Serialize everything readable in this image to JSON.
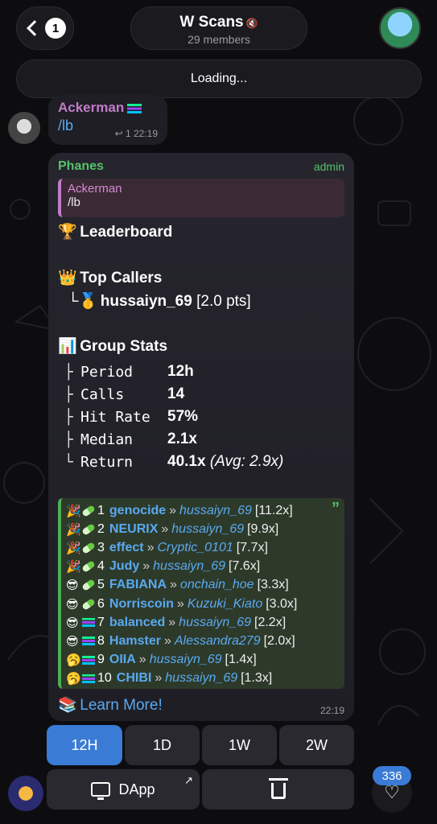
{
  "header": {
    "back_badge": "1",
    "title": "W Scans",
    "mute_icon": "muted-speaker-icon",
    "subtitle": "29 members",
    "loading": "Loading..."
  },
  "message1": {
    "sender": "Ackerman",
    "text": "/lb",
    "meta": "↩ 1  22:19"
  },
  "message2": {
    "sender": "Phanes",
    "role": "admin",
    "reply_sender": "Ackerman",
    "reply_text": "/lb",
    "leaderboard_title": "Leaderboard",
    "top_callers_title": "Top Callers",
    "top_caller_name": "hussaiyn_69",
    "top_caller_pts": "[2.0 pts]",
    "group_stats_title": "Group Stats",
    "stats": [
      {
        "tree": "├",
        "key": "Period",
        "value": "12h",
        "extra": ""
      },
      {
        "tree": "├",
        "key": "Calls",
        "value": "14",
        "extra": ""
      },
      {
        "tree": "├",
        "key": "Hit Rate",
        "value": "57%",
        "extra": ""
      },
      {
        "tree": "├",
        "key": "Median",
        "value": "2.1x",
        "extra": ""
      },
      {
        "tree": "└",
        "key": "Return",
        "value": "40.1x",
        "extra": "(Avg: 2.9x)"
      }
    ],
    "tokens": [
      {
        "icon": "🎉",
        "rank": "1",
        "name": "genocide",
        "caller": "hussaiyn_69",
        "mult": "[11.2x]",
        "chain": "pill"
      },
      {
        "icon": "🎉",
        "rank": "2",
        "name": "NEURIX",
        "caller": "hussaiyn_69",
        "mult": "[9.9x]",
        "chain": "pill"
      },
      {
        "icon": "🎉",
        "rank": "3",
        "name": "effect",
        "caller": "Cryptic_0101",
        "mult": "[7.7x]",
        "chain": "pill"
      },
      {
        "icon": "🎉",
        "rank": "4",
        "name": "Judy",
        "caller": "hussaiyn_69",
        "mult": "[7.6x]",
        "chain": "pill"
      },
      {
        "icon": "😎",
        "rank": "5",
        "name": "FABIANA",
        "caller": "onchain_hoe",
        "mult": "[3.3x]",
        "chain": "pill"
      },
      {
        "icon": "😎",
        "rank": "6",
        "name": "Norriscoin",
        "caller": "Kuzuki_Kiato",
        "mult": "[3.0x]",
        "chain": "pill"
      },
      {
        "icon": "😎",
        "rank": "7",
        "name": "balanced",
        "caller": "hussaiyn_69",
        "mult": "[2.2x]",
        "chain": "sol"
      },
      {
        "icon": "😎",
        "rank": "8",
        "name": "Hamster",
        "caller": "Alessandra279",
        "mult": "[2.0x]",
        "chain": "sol"
      },
      {
        "icon": "🥱",
        "rank": "9",
        "name": "OIIA",
        "caller": "hussaiyn_69",
        "mult": "[1.4x]",
        "chain": "sol"
      },
      {
        "icon": "🥱",
        "rank": "10",
        "name": "CHIBI",
        "caller": "hussaiyn_69",
        "mult": "[1.3x]",
        "chain": "sol"
      }
    ],
    "learn_more": "Learn More!",
    "time": "22:19"
  },
  "keyboard": {
    "periods": [
      "12H",
      "1D",
      "1W",
      "2W"
    ],
    "active_period": "12H",
    "dapp_label": "DApp",
    "delete_icon": "trash-icon"
  },
  "footer": {
    "favorite_count": "336"
  }
}
